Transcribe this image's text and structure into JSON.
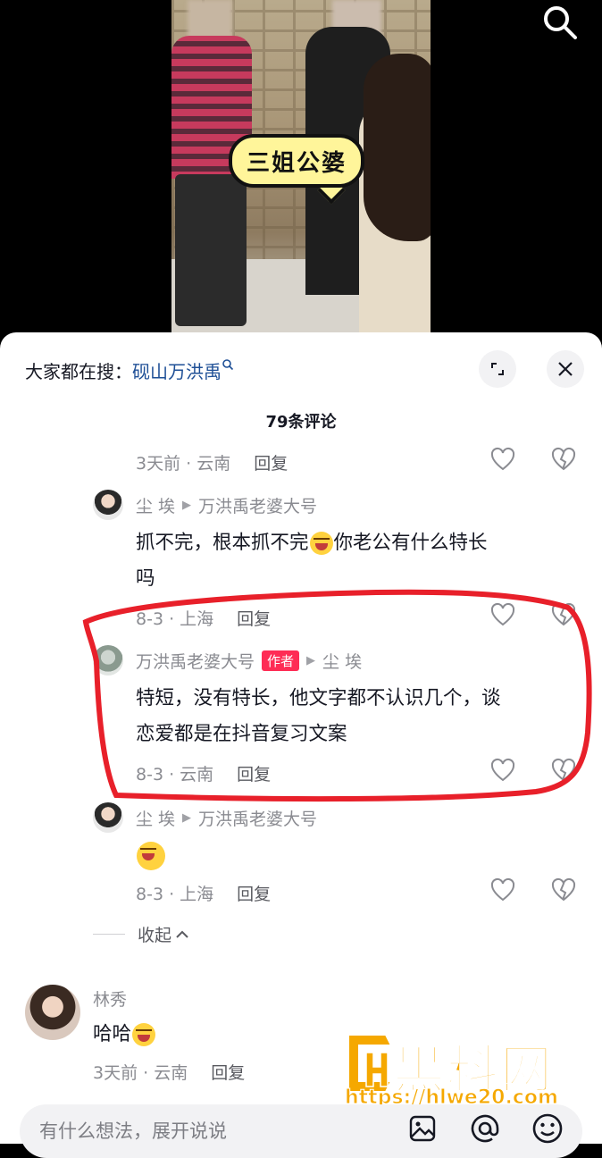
{
  "video": {
    "caption": "三姐公婆"
  },
  "panel": {
    "search_hint_prefix": "大家都在搜：",
    "search_hint_keyword": "砚山万洪禹",
    "comment_count": "79条评论"
  },
  "comments": {
    "c0": {
      "meta": "3天前 · 云南",
      "reply_label": "回复"
    },
    "c1": {
      "user": "尘 埃",
      "reply_to": "万洪禹老婆大号",
      "text_a": "抓不完，根本抓不完",
      "text_b": "你老公有什么特长",
      "text_c": "吗",
      "meta": "8-3 · 上海",
      "reply_label": "回复"
    },
    "c2": {
      "user": "万洪禹老婆大号",
      "badge": "作者",
      "reply_to": "尘 埃",
      "text_1": "特短，没有特长，他文字都不认识几个，谈",
      "text_2": "恋爱都是在抖音复习文案",
      "meta": "8-3 · 云南",
      "reply_label": "回复"
    },
    "c3": {
      "user": "尘 埃",
      "reply_to": "万洪禹老婆大号",
      "meta": "8-3 · 上海",
      "reply_label": "回复"
    },
    "collapse_label": "收起",
    "c4": {
      "user": "林秀",
      "text": "哈哈",
      "meta": "3天前 · 云南",
      "reply_label": "回复"
    }
  },
  "input": {
    "placeholder": "有什么想法，展开说说"
  },
  "watermark": {
    "brand": "黑料网",
    "url": "https://hlwe20.com"
  },
  "colors": {
    "annotation_red": "#e8202a",
    "watermark_orange": "#f5a800",
    "keyword_blue": "#1e4f96"
  }
}
